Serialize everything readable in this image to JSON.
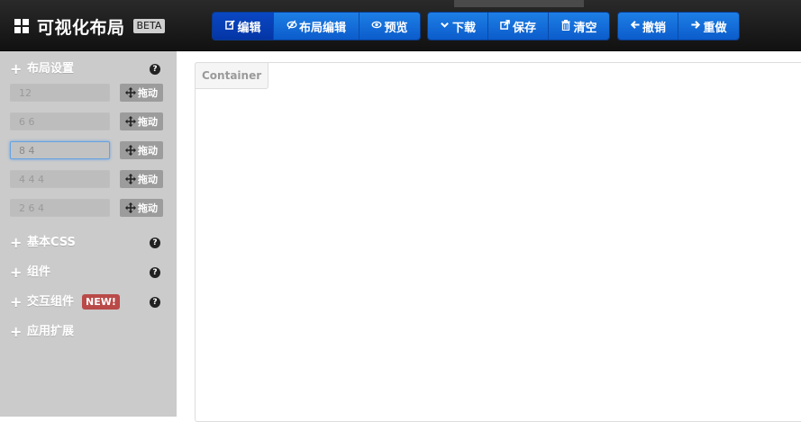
{
  "brand": {
    "title": "可视化布局",
    "badge": "BETA"
  },
  "toolbar": {
    "group1": [
      {
        "label": "编辑",
        "icon": "edit-icon",
        "active": true
      },
      {
        "label": "布局编辑",
        "icon": "eye-slash-icon",
        "active": false
      },
      {
        "label": "预览",
        "icon": "eye-icon",
        "active": false
      }
    ],
    "group2": [
      {
        "label": "下载",
        "icon": "chevron-down-icon"
      },
      {
        "label": "保存",
        "icon": "share-icon"
      },
      {
        "label": "清空",
        "icon": "trash-icon"
      }
    ],
    "group3": [
      {
        "label": "撤销",
        "icon": "arrow-left-icon"
      },
      {
        "label": "重做",
        "icon": "arrow-right-icon"
      }
    ]
  },
  "sidebar": {
    "layout_section": {
      "label": "布局设置",
      "help": "?"
    },
    "grid_rows": [
      {
        "value": "12",
        "drag_label": "拖动",
        "focused": false
      },
      {
        "value": "6 6",
        "drag_label": "拖动",
        "focused": false
      },
      {
        "value": "8 4",
        "drag_label": "拖动",
        "focused": true
      },
      {
        "value": "4 4 4",
        "drag_label": "拖动",
        "focused": false
      },
      {
        "value": "2 6 4",
        "drag_label": "拖动",
        "focused": false
      }
    ],
    "sections": [
      {
        "label": "基本CSS",
        "help": "?",
        "badge": ""
      },
      {
        "label": "组件",
        "help": "?",
        "badge": ""
      },
      {
        "label": "交互组件",
        "help": "?",
        "badge": "NEW!"
      },
      {
        "label": "应用扩展",
        "help": "",
        "badge": ""
      }
    ]
  },
  "main": {
    "container_label": "Container"
  },
  "colors": {
    "primary_button": "#0b5ccb",
    "active_button": "#0435a5",
    "sidebar_bg": "#cbcbcb",
    "new_badge": "#b94a48"
  }
}
